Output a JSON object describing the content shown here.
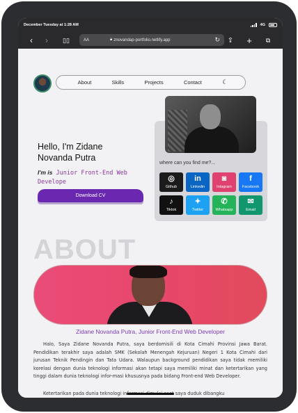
{
  "status_bar": {
    "datetime": "December Tuesday at 1:28 AM",
    "network": "4G"
  },
  "browser": {
    "text_size_label": "AA",
    "url": "znovandap-portfolio.netlify.app"
  },
  "nav": {
    "items": [
      "About",
      "Skills",
      "Projects",
      "Contact"
    ]
  },
  "hero": {
    "greeting": "Hello, I'm Zidane Novanda Putra",
    "role_prefix": "I'm is",
    "role": "Junior Front-End Web Develope",
    "cv_button": "Download CV"
  },
  "social": {
    "heading": "where can you find me?...",
    "buttons": [
      {
        "label": "Github",
        "icon": "github-icon",
        "glyph": "◎",
        "color": "#1b1b1b"
      },
      {
        "label": "Linkedin",
        "icon": "linkedin-icon",
        "glyph": "in",
        "color": "#0a66c2"
      },
      {
        "label": "Intagram",
        "icon": "instagram-icon",
        "glyph": "◙",
        "color": "#e0426f"
      },
      {
        "label": "Facebook",
        "icon": "facebook-icon",
        "glyph": "f",
        "color": "#1877f2"
      },
      {
        "label": "Tiktok",
        "icon": "tiktok-icon",
        "glyph": "♪",
        "color": "#111111"
      },
      {
        "label": "Twitter",
        "icon": "twitter-icon",
        "glyph": "✦",
        "color": "#1da1f2"
      },
      {
        "label": "Whatsapp",
        "icon": "whatsapp-icon",
        "glyph": "✆",
        "color": "#25b35a"
      },
      {
        "label": "Email",
        "icon": "email-icon",
        "glyph": "✉",
        "color": "#11966e"
      }
    ]
  },
  "about": {
    "heading": "ABOUT",
    "name_title": "Zidane Novanda Putra, Junior Front-End Web Developer",
    "paragraph1": "Halo, Saya Zidane Novanda Putra, saya berdomisili di Kota Cimahi Provinsi Jawa Barat. Pendidikan terakhir saya adalah SMK (Sekolah Menengah Kejuruan) Negeri 1 Kota Cimahi dari jurusan Teknik Pendingin dan Tata Udara. Walaupun background pendidikan saya tidak memiliki korelasi dengan dunia teknologi informasi akan tetapi saya memiliki minat dan ketertarikan yang tinggi dalam dunia teknologi infor-masi khususnya pada bidang Front-end Web Developer.",
    "paragraph2": "Ketertarikan pada dunia teknologi informasi dimulai saat saya duduk dibangku"
  }
}
